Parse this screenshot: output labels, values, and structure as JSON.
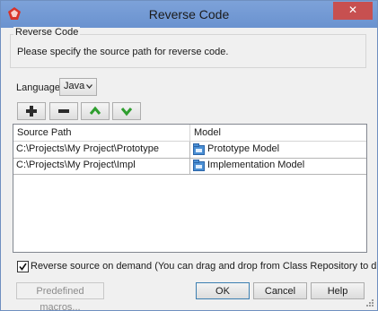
{
  "window": {
    "title": "Reverse Code",
    "close_label": "✕"
  },
  "group": {
    "legend": "Reverse Code",
    "description": "Please specify the source path for reverse code."
  },
  "language": {
    "label": "Language:",
    "selected": "Java"
  },
  "toolbar": [
    "plus-icon",
    "minus-icon",
    "arrow-up-icon",
    "arrow-down-icon"
  ],
  "table": {
    "columns": [
      "Source Path",
      "Model"
    ],
    "rows": [
      {
        "path": "C:\\Projects\\My Project\\Prototype",
        "model": "Prototype Model"
      },
      {
        "path": "C:\\Projects\\My Project\\Impl",
        "model": "Implementation Model"
      }
    ]
  },
  "option": {
    "checked": true,
    "label": "Reverse source on demand (You can drag and drop from Class Repository to diagram to reverse)"
  },
  "buttons": {
    "macros": "Predefined macros...",
    "ok": "OK",
    "cancel": "Cancel",
    "help": "Help"
  },
  "colors": {
    "titlebar": "#6a92cf",
    "close": "#c75050",
    "accent_green": "#2e9e2e"
  }
}
